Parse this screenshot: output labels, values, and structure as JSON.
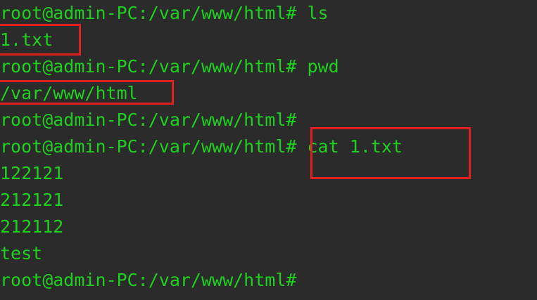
{
  "terminal": {
    "lines": [
      "root@admin-PC:/var/www/html# ls",
      "1.txt",
      "root@admin-PC:/var/www/html# pwd",
      "/var/www/html",
      "root@admin-PC:/var/www/html#",
      "root@admin-PC:/var/www/html# cat 1.txt",
      "122121",
      "212121",
      "212112",
      "test",
      "root@admin-PC:/var/www/html#"
    ]
  },
  "colors": {
    "background": "#2b2b2b",
    "text": "#1fd11f",
    "highlight_box": "#e11f1f"
  }
}
